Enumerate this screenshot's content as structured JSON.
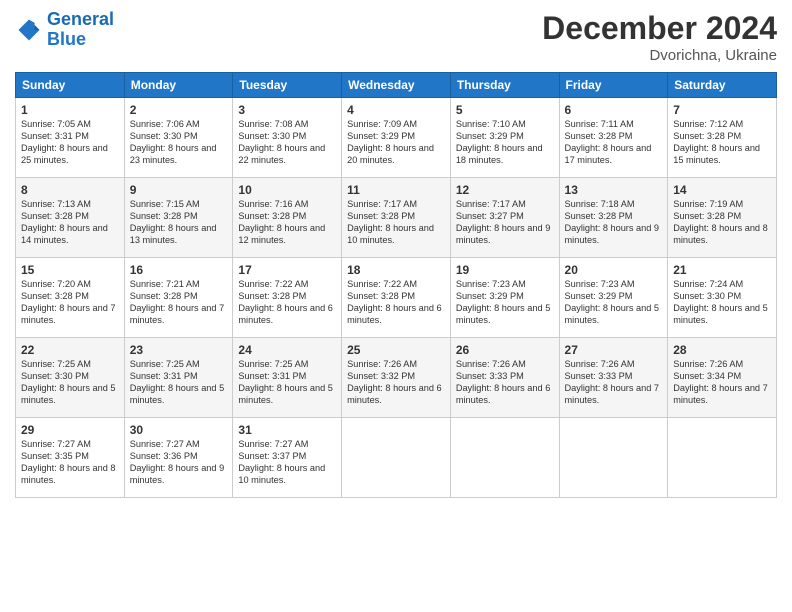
{
  "header": {
    "logo_line1": "General",
    "logo_line2": "Blue",
    "title": "December 2024",
    "subtitle": "Dvorichna, Ukraine"
  },
  "columns": [
    "Sunday",
    "Monday",
    "Tuesday",
    "Wednesday",
    "Thursday",
    "Friday",
    "Saturday"
  ],
  "rows": [
    [
      {
        "day": "1",
        "sunrise": "Sunrise: 7:05 AM",
        "sunset": "Sunset: 3:31 PM",
        "daylight": "Daylight: 8 hours and 25 minutes."
      },
      {
        "day": "2",
        "sunrise": "Sunrise: 7:06 AM",
        "sunset": "Sunset: 3:30 PM",
        "daylight": "Daylight: 8 hours and 23 minutes."
      },
      {
        "day": "3",
        "sunrise": "Sunrise: 7:08 AM",
        "sunset": "Sunset: 3:30 PM",
        "daylight": "Daylight: 8 hours and 22 minutes."
      },
      {
        "day": "4",
        "sunrise": "Sunrise: 7:09 AM",
        "sunset": "Sunset: 3:29 PM",
        "daylight": "Daylight: 8 hours and 20 minutes."
      },
      {
        "day": "5",
        "sunrise": "Sunrise: 7:10 AM",
        "sunset": "Sunset: 3:29 PM",
        "daylight": "Daylight: 8 hours and 18 minutes."
      },
      {
        "day": "6",
        "sunrise": "Sunrise: 7:11 AM",
        "sunset": "Sunset: 3:28 PM",
        "daylight": "Daylight: 8 hours and 17 minutes."
      },
      {
        "day": "7",
        "sunrise": "Sunrise: 7:12 AM",
        "sunset": "Sunset: 3:28 PM",
        "daylight": "Daylight: 8 hours and 15 minutes."
      }
    ],
    [
      {
        "day": "8",
        "sunrise": "Sunrise: 7:13 AM",
        "sunset": "Sunset: 3:28 PM",
        "daylight": "Daylight: 8 hours and 14 minutes."
      },
      {
        "day": "9",
        "sunrise": "Sunrise: 7:15 AM",
        "sunset": "Sunset: 3:28 PM",
        "daylight": "Daylight: 8 hours and 13 minutes."
      },
      {
        "day": "10",
        "sunrise": "Sunrise: 7:16 AM",
        "sunset": "Sunset: 3:28 PM",
        "daylight": "Daylight: 8 hours and 12 minutes."
      },
      {
        "day": "11",
        "sunrise": "Sunrise: 7:17 AM",
        "sunset": "Sunset: 3:28 PM",
        "daylight": "Daylight: 8 hours and 10 minutes."
      },
      {
        "day": "12",
        "sunrise": "Sunrise: 7:17 AM",
        "sunset": "Sunset: 3:27 PM",
        "daylight": "Daylight: 8 hours and 9 minutes."
      },
      {
        "day": "13",
        "sunrise": "Sunrise: 7:18 AM",
        "sunset": "Sunset: 3:28 PM",
        "daylight": "Daylight: 8 hours and 9 minutes."
      },
      {
        "day": "14",
        "sunrise": "Sunrise: 7:19 AM",
        "sunset": "Sunset: 3:28 PM",
        "daylight": "Daylight: 8 hours and 8 minutes."
      }
    ],
    [
      {
        "day": "15",
        "sunrise": "Sunrise: 7:20 AM",
        "sunset": "Sunset: 3:28 PM",
        "daylight": "Daylight: 8 hours and 7 minutes."
      },
      {
        "day": "16",
        "sunrise": "Sunrise: 7:21 AM",
        "sunset": "Sunset: 3:28 PM",
        "daylight": "Daylight: 8 hours and 7 minutes."
      },
      {
        "day": "17",
        "sunrise": "Sunrise: 7:22 AM",
        "sunset": "Sunset: 3:28 PM",
        "daylight": "Daylight: 8 hours and 6 minutes."
      },
      {
        "day": "18",
        "sunrise": "Sunrise: 7:22 AM",
        "sunset": "Sunset: 3:28 PM",
        "daylight": "Daylight: 8 hours and 6 minutes."
      },
      {
        "day": "19",
        "sunrise": "Sunrise: 7:23 AM",
        "sunset": "Sunset: 3:29 PM",
        "daylight": "Daylight: 8 hours and 5 minutes."
      },
      {
        "day": "20",
        "sunrise": "Sunrise: 7:23 AM",
        "sunset": "Sunset: 3:29 PM",
        "daylight": "Daylight: 8 hours and 5 minutes."
      },
      {
        "day": "21",
        "sunrise": "Sunrise: 7:24 AM",
        "sunset": "Sunset: 3:30 PM",
        "daylight": "Daylight: 8 hours and 5 minutes."
      }
    ],
    [
      {
        "day": "22",
        "sunrise": "Sunrise: 7:25 AM",
        "sunset": "Sunset: 3:30 PM",
        "daylight": "Daylight: 8 hours and 5 minutes."
      },
      {
        "day": "23",
        "sunrise": "Sunrise: 7:25 AM",
        "sunset": "Sunset: 3:31 PM",
        "daylight": "Daylight: 8 hours and 5 minutes."
      },
      {
        "day": "24",
        "sunrise": "Sunrise: 7:25 AM",
        "sunset": "Sunset: 3:31 PM",
        "daylight": "Daylight: 8 hours and 5 minutes."
      },
      {
        "day": "25",
        "sunrise": "Sunrise: 7:26 AM",
        "sunset": "Sunset: 3:32 PM",
        "daylight": "Daylight: 8 hours and 6 minutes."
      },
      {
        "day": "26",
        "sunrise": "Sunrise: 7:26 AM",
        "sunset": "Sunset: 3:33 PM",
        "daylight": "Daylight: 8 hours and 6 minutes."
      },
      {
        "day": "27",
        "sunrise": "Sunrise: 7:26 AM",
        "sunset": "Sunset: 3:33 PM",
        "daylight": "Daylight: 8 hours and 7 minutes."
      },
      {
        "day": "28",
        "sunrise": "Sunrise: 7:26 AM",
        "sunset": "Sunset: 3:34 PM",
        "daylight": "Daylight: 8 hours and 7 minutes."
      }
    ],
    [
      {
        "day": "29",
        "sunrise": "Sunrise: 7:27 AM",
        "sunset": "Sunset: 3:35 PM",
        "daylight": "Daylight: 8 hours and 8 minutes."
      },
      {
        "day": "30",
        "sunrise": "Sunrise: 7:27 AM",
        "sunset": "Sunset: 3:36 PM",
        "daylight": "Daylight: 8 hours and 9 minutes."
      },
      {
        "day": "31",
        "sunrise": "Sunrise: 7:27 AM",
        "sunset": "Sunset: 3:37 PM",
        "daylight": "Daylight: 8 hours and 10 minutes."
      },
      null,
      null,
      null,
      null
    ]
  ]
}
